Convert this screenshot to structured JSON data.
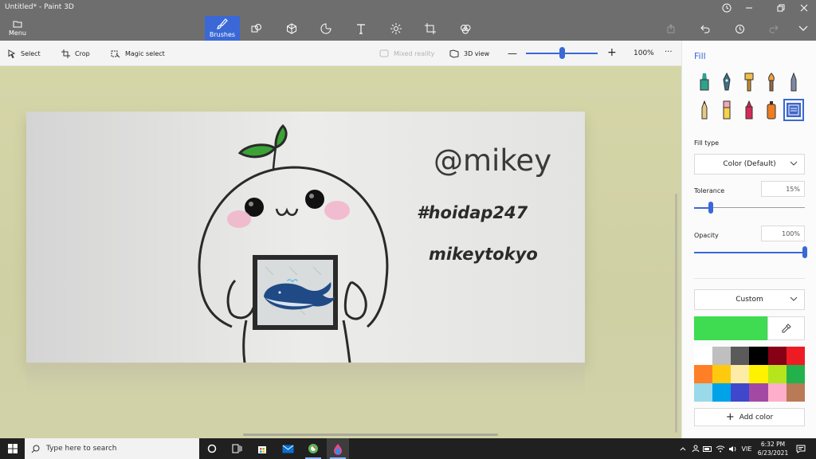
{
  "window": {
    "title": "Untitled* - Paint 3D"
  },
  "ribbon": {
    "menu_label": "Menu",
    "brushes_label": "Brushes",
    "tool_icons": [
      "2d-shapes-icon",
      "3d-shapes-icon",
      "stickers-icon",
      "text-icon",
      "effects-icon",
      "canvas-icon",
      "3d-library-icon"
    ]
  },
  "commandbar": {
    "select": "Select",
    "crop": "Crop",
    "magic_select": "Magic select",
    "mixed_reality": "Mixed reality",
    "view_3d": "3D view",
    "zoom": "100%",
    "zoom_level": 0.5,
    "more": "···"
  },
  "canvas": {
    "handle": "@mikey",
    "hashtag": "#hoidap247",
    "name": "mikeytokyo"
  },
  "panel": {
    "title": "Fill",
    "fill_type_label": "Fill type",
    "fill_type_value": "Color (Default)",
    "tolerance_label": "Tolerance",
    "tolerance_value": "15%",
    "tolerance_level": 0.15,
    "opacity_label": "Opacity",
    "opacity_value": "100%",
    "opacity_level": 1.0,
    "color_mode": "Custom",
    "current_color": "#3fdb51",
    "add_color_label": "Add color",
    "palette": [
      "#ffffff",
      "#bfbfbf",
      "#5a5a5a",
      "#000000",
      "#880015",
      "#ed1c24",
      "#ff7f27",
      "#ffc90e",
      "#fdeca6",
      "#fff200",
      "#b5e61d",
      "#22b14c",
      "#99d9ea",
      "#00a2e8",
      "#3f48cc",
      "#a349a4",
      "#ffaec9",
      "#b97a57"
    ]
  },
  "taskbar": {
    "search_placeholder": "Type here to search",
    "language": "VIE",
    "time": "6:32 PM",
    "date": "6/23/2021"
  }
}
